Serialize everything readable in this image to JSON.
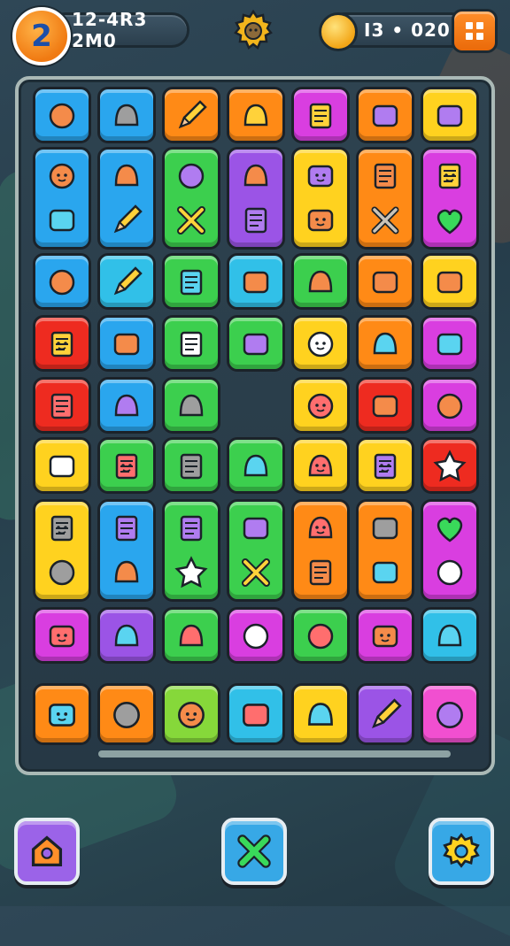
{
  "hud": {
    "level": "2",
    "score_text": "12-4R3 2M0",
    "coins_text": "I3 • 020"
  },
  "colors": {
    "blue": "#2aa6ee",
    "cyan": "#31c0e8",
    "green": "#3ccf4e",
    "lime": "#86d83a",
    "yellow": "#ffd21f",
    "orange": "#ff8a16",
    "red": "#ee2b20",
    "magenta": "#d93ee0",
    "purple": "#9b54e6",
    "pink": "#f14fd0"
  },
  "board": {
    "rows": [
      [
        {
          "color": "blue",
          "icons": [
            "notepad-icon"
          ]
        },
        {
          "color": "blue",
          "icons": [
            "envelope-icon"
          ]
        },
        {
          "color": "orange",
          "icons": [
            "pencil-icon"
          ]
        },
        {
          "color": "orange",
          "icons": [
            "rocket-icon"
          ]
        },
        {
          "color": "magenta",
          "icons": [
            "document-icon"
          ]
        },
        {
          "color": "orange",
          "icons": [
            "calendar-icon"
          ]
        },
        {
          "color": "yellow",
          "icons": [
            "folder-icon"
          ]
        }
      ],
      [
        {
          "color": "blue",
          "icons": [
            "blob-icon",
            "leaf-icon"
          ]
        },
        {
          "color": "blue",
          "icons": [
            "ticket-icon",
            "pencil-icon"
          ]
        },
        {
          "color": "green",
          "icons": [
            "shield-icon",
            "cross-tools-icon"
          ]
        },
        {
          "color": "purple",
          "icons": [
            "bean-icon",
            "flame-icon"
          ]
        },
        {
          "color": "yellow",
          "icons": [
            "robot-icon",
            "bunny-icon"
          ]
        },
        {
          "color": "orange",
          "icons": [
            "mirror-icon",
            "wrench-cross-icon"
          ]
        },
        {
          "color": "magenta",
          "icons": [
            "balloon-face-icon",
            "heart-icon"
          ]
        }
      ],
      [
        {
          "color": "blue",
          "icons": [
            "app-icon"
          ]
        },
        {
          "color": "cyan",
          "icons": [
            "pencil-icon"
          ]
        },
        {
          "color": "green",
          "icons": [
            "gem-icon"
          ]
        },
        {
          "color": "cyan",
          "icons": [
            "brush-icon"
          ]
        },
        {
          "color": "green",
          "icons": [
            "eraser-icon"
          ]
        },
        {
          "color": "orange",
          "icons": [
            "hammer-icon"
          ]
        },
        {
          "color": "yellow",
          "icons": [
            "donut-icon"
          ]
        }
      ],
      [
        {
          "color": "red",
          "icons": [
            "box-face-icon"
          ]
        },
        {
          "color": "blue",
          "icons": [
            "brush-icon"
          ]
        },
        {
          "color": "green",
          "icons": [
            "crate-icon"
          ]
        },
        {
          "color": "green",
          "icons": [
            "tag-icon"
          ]
        },
        {
          "color": "yellow",
          "icons": [
            "smiley-icon"
          ]
        },
        {
          "color": "orange",
          "icons": [
            "sun-gear-icon"
          ]
        },
        {
          "color": "magenta",
          "icons": [
            "gameboy-icon"
          ]
        }
      ],
      [
        {
          "color": "red",
          "icons": [
            "dice-icon"
          ]
        },
        {
          "color": "blue",
          "icons": [
            "bag-icon"
          ]
        },
        {
          "color": "green",
          "icons": [
            "planet-icon"
          ]
        },
        null,
        {
          "color": "yellow",
          "icons": [
            "moon-face-icon"
          ]
        },
        {
          "color": "red",
          "icons": [
            "calculator-icon"
          ]
        },
        {
          "color": "magenta",
          "icons": [
            "notepad-icon"
          ]
        }
      ],
      [
        {
          "color": "yellow",
          "icons": [
            "ruler-icon"
          ]
        },
        {
          "color": "green",
          "icons": [
            "jar-face-icon"
          ]
        },
        {
          "color": "green",
          "icons": [
            "mallet-icon"
          ]
        },
        {
          "color": "green",
          "icons": [
            "paper-icon"
          ]
        },
        {
          "color": "yellow",
          "icons": [
            "cat-face-icon"
          ]
        },
        {
          "color": "yellow",
          "icons": [
            "bell-face-icon"
          ]
        },
        {
          "color": "red",
          "icons": [
            "star-icon"
          ]
        }
      ],
      [
        {
          "color": "yellow",
          "icons": [
            "hat-face-icon",
            "glove-icon"
          ]
        },
        {
          "color": "blue",
          "icons": [
            "flame-icon",
            "triangle-icon"
          ]
        },
        {
          "color": "green",
          "icons": [
            "flame-icon",
            "star-icon"
          ]
        },
        {
          "color": "green",
          "icons": [
            "folder-icon",
            "cross-tools-icon"
          ]
        },
        {
          "color": "orange",
          "icons": [
            "cat-face-icon",
            "flower-icon"
          ]
        },
        {
          "color": "orange",
          "icons": [
            "briefcase-icon",
            "microphone-icon"
          ]
        },
        {
          "color": "magenta",
          "icons": [
            "heart-icon",
            "wrench-icon"
          ]
        }
      ],
      [
        {
          "color": "magenta",
          "icons": [
            "bubble-face-icon"
          ]
        },
        {
          "color": "purple",
          "icons": [
            "fish-icon"
          ]
        },
        {
          "color": "green",
          "icons": [
            "cookie-icon"
          ]
        },
        {
          "color": "magenta",
          "icons": [
            "lock-box-icon"
          ]
        },
        {
          "color": "green",
          "icons": [
            "bird-icon"
          ]
        },
        {
          "color": "magenta",
          "icons": [
            "monster-icon"
          ]
        },
        {
          "color": "cyan",
          "icons": [
            "fish-icon"
          ]
        }
      ]
    ]
  },
  "tray": [
    {
      "color": "orange",
      "icon": "sun-face-icon"
    },
    {
      "color": "orange",
      "icon": "piano-icon"
    },
    {
      "color": "lime",
      "icon": "blob-icon"
    },
    {
      "color": "cyan",
      "icon": "phone-icon"
    },
    {
      "color": "yellow",
      "icon": "sun-gear-icon"
    },
    {
      "color": "purple",
      "icon": "pencil-icon"
    },
    {
      "color": "pink",
      "icon": "cloud-icon"
    }
  ],
  "bottom_buttons": [
    {
      "name": "home-button",
      "icon": "home-icon",
      "color": "#9b63e8"
    },
    {
      "name": "shuffle-button",
      "icon": "cross-icon",
      "color": "#37a8e6"
    },
    {
      "name": "settings-button",
      "icon": "gear-icon",
      "color": "#37a8e6"
    }
  ]
}
